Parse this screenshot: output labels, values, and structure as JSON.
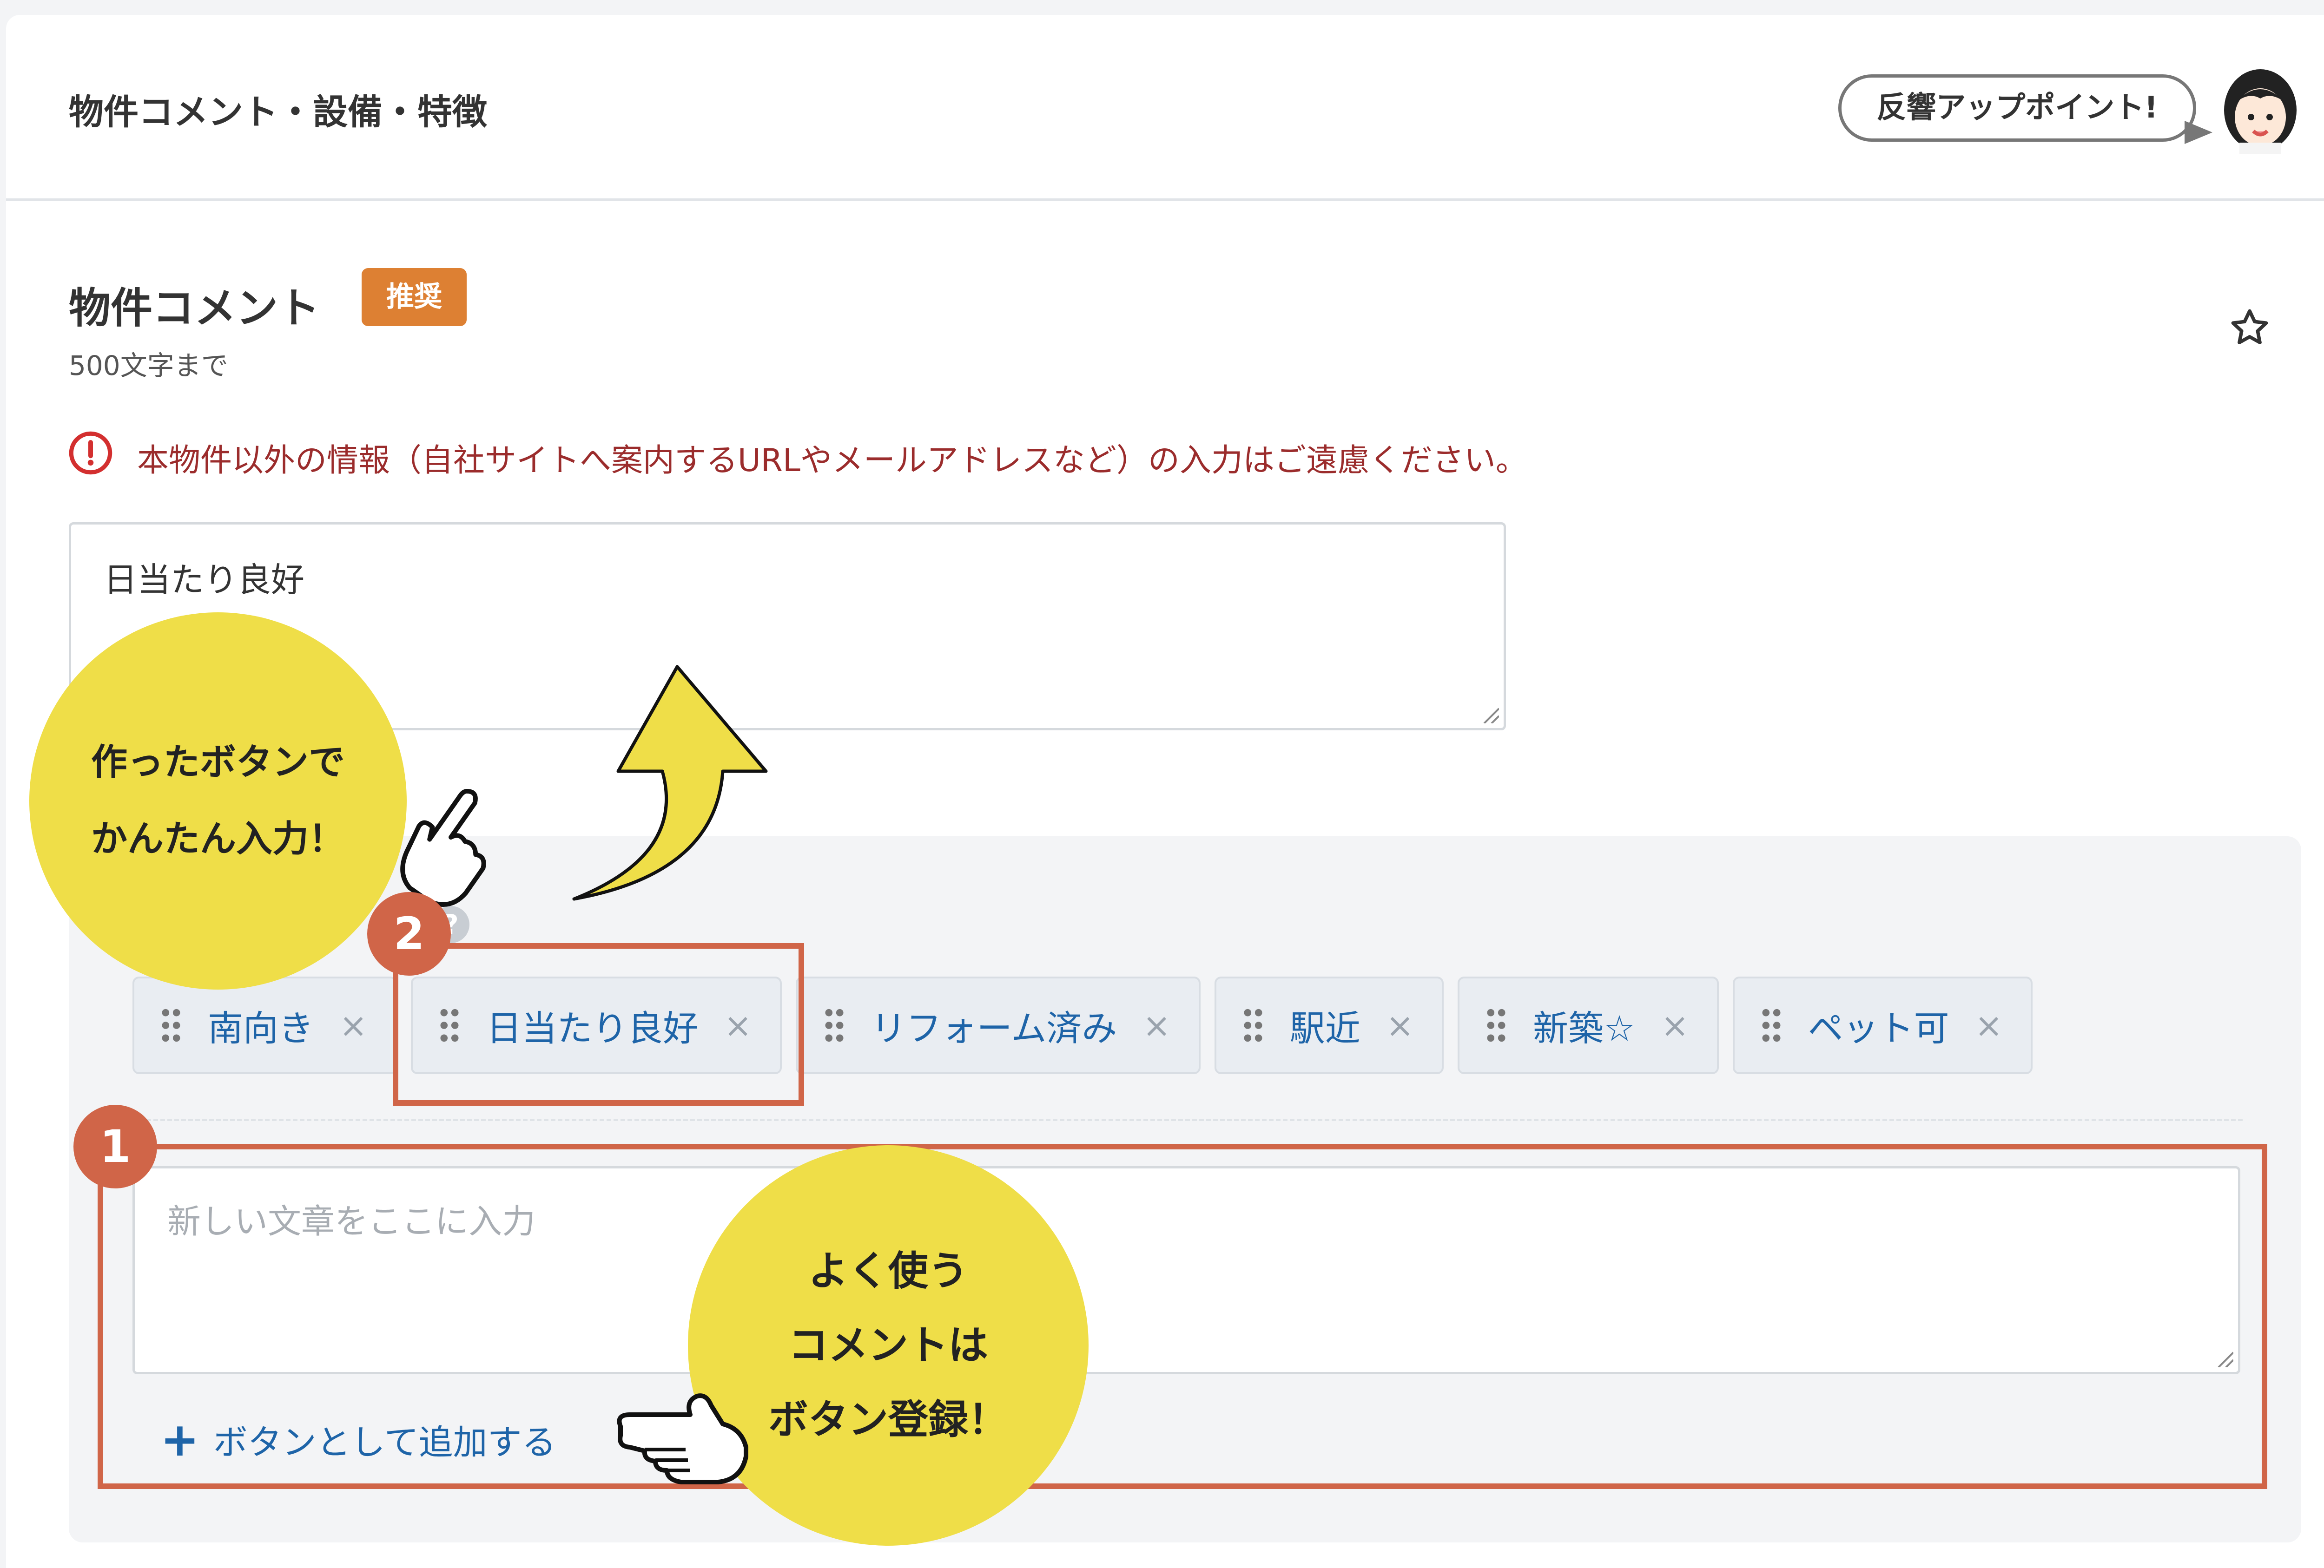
{
  "header": {
    "title": "物件コメント・設備・特徴",
    "bubble_text": "反響アップポイント!"
  },
  "section": {
    "title": "物件コメント",
    "badge": "推奨",
    "limit_text": "500文字まで",
    "warning_text": "本物件以外の情報（自社サイトへ案内するURLやメールアドレスなど）の入力はご遠慮ください。"
  },
  "comment_textarea": {
    "value": "日当たり良好"
  },
  "phrase_panel": {
    "help_label": "?",
    "chips": [
      {
        "label": "南向き",
        "remove": "×"
      },
      {
        "label": "日当たり良好",
        "remove": "×"
      },
      {
        "label": "リフォーム済み",
        "remove": "×"
      },
      {
        "label": "駅近",
        "remove": "×"
      },
      {
        "label": "新築☆",
        "remove": "×"
      },
      {
        "label": "ペット可",
        "remove": "×"
      }
    ],
    "new_textarea": {
      "placeholder": "新しい文章をここに入力"
    },
    "add_button_label": "ボタンとして追加する",
    "add_button_icon": "+"
  },
  "annotations": {
    "callout1_line1": "作ったボタンで",
    "callout1_line2": "かんたん入力！",
    "callout2_line1": "よく使う",
    "callout2_line2": "コメントは",
    "callout2_line3": "ボタン登録！",
    "marker1": "1",
    "marker2": "2",
    "accent_color": "#d06548",
    "callout_color": "#efde48",
    "badge_color": "#dd8033",
    "link_color": "#1e64a8"
  },
  "icons": [
    "star-icon",
    "warning-icon",
    "drag-handle-icon",
    "close-icon",
    "plus-icon",
    "help-icon",
    "pointing-hand-icon",
    "up-arrow-icon",
    "avatar"
  ]
}
